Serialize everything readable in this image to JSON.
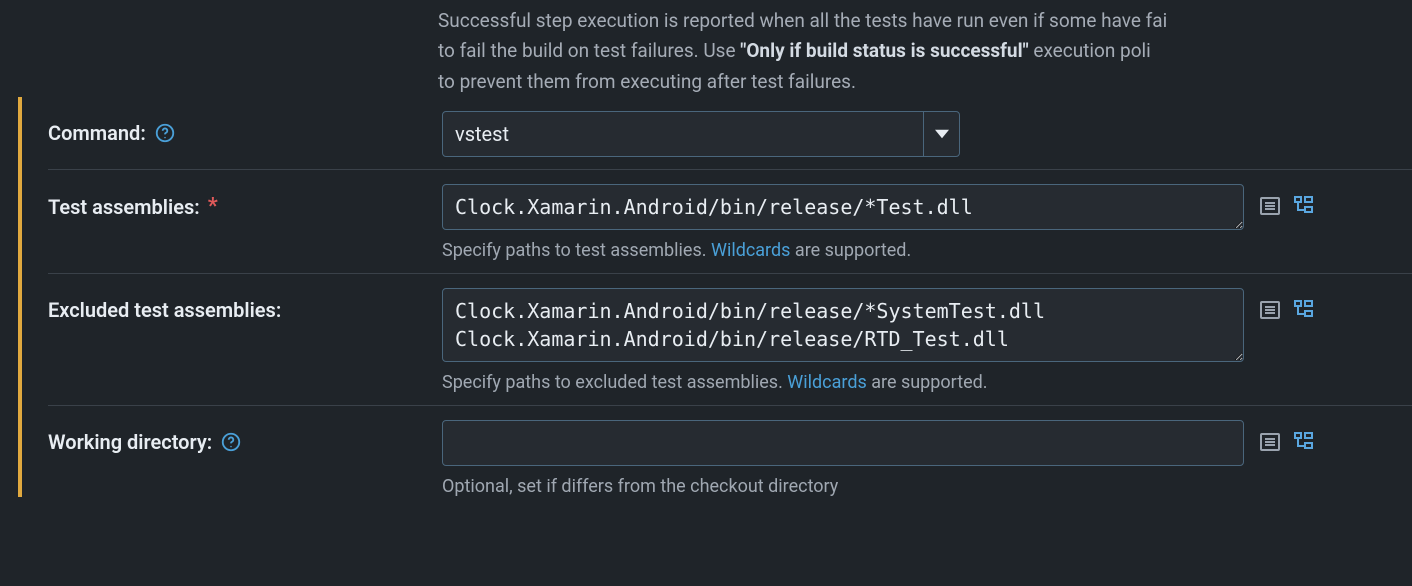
{
  "intro": {
    "line1_a": "Successful step execution is reported when all the tests have run even if some have fai",
    "line2_a": "to fail the build on test failures. Use ",
    "line2_strong": "\"Only if build status is successful\"",
    "line2_b": " execution poli",
    "line3": "to prevent them from executing after test failures."
  },
  "command": {
    "label": "Command:",
    "value": "vstest"
  },
  "test_assemblies": {
    "label": "Test assemblies:",
    "value": "Clock.Xamarin.Android/bin/release/*Test.dll",
    "hint_a": "Specify paths to test assemblies. ",
    "hint_link": "Wildcards",
    "hint_b": " are supported."
  },
  "excluded": {
    "label": "Excluded test assemblies:",
    "value": "Clock.Xamarin.Android/bin/release/*SystemTest.dll\nClock.Xamarin.Android/bin/release/RTD_Test.dll",
    "hint_a": "Specify paths to excluded test assemblies. ",
    "hint_link": "Wildcards",
    "hint_b": " are supported."
  },
  "working_dir": {
    "label": "Working directory:",
    "value": "",
    "hint": "Optional, set if differs from the checkout directory"
  }
}
